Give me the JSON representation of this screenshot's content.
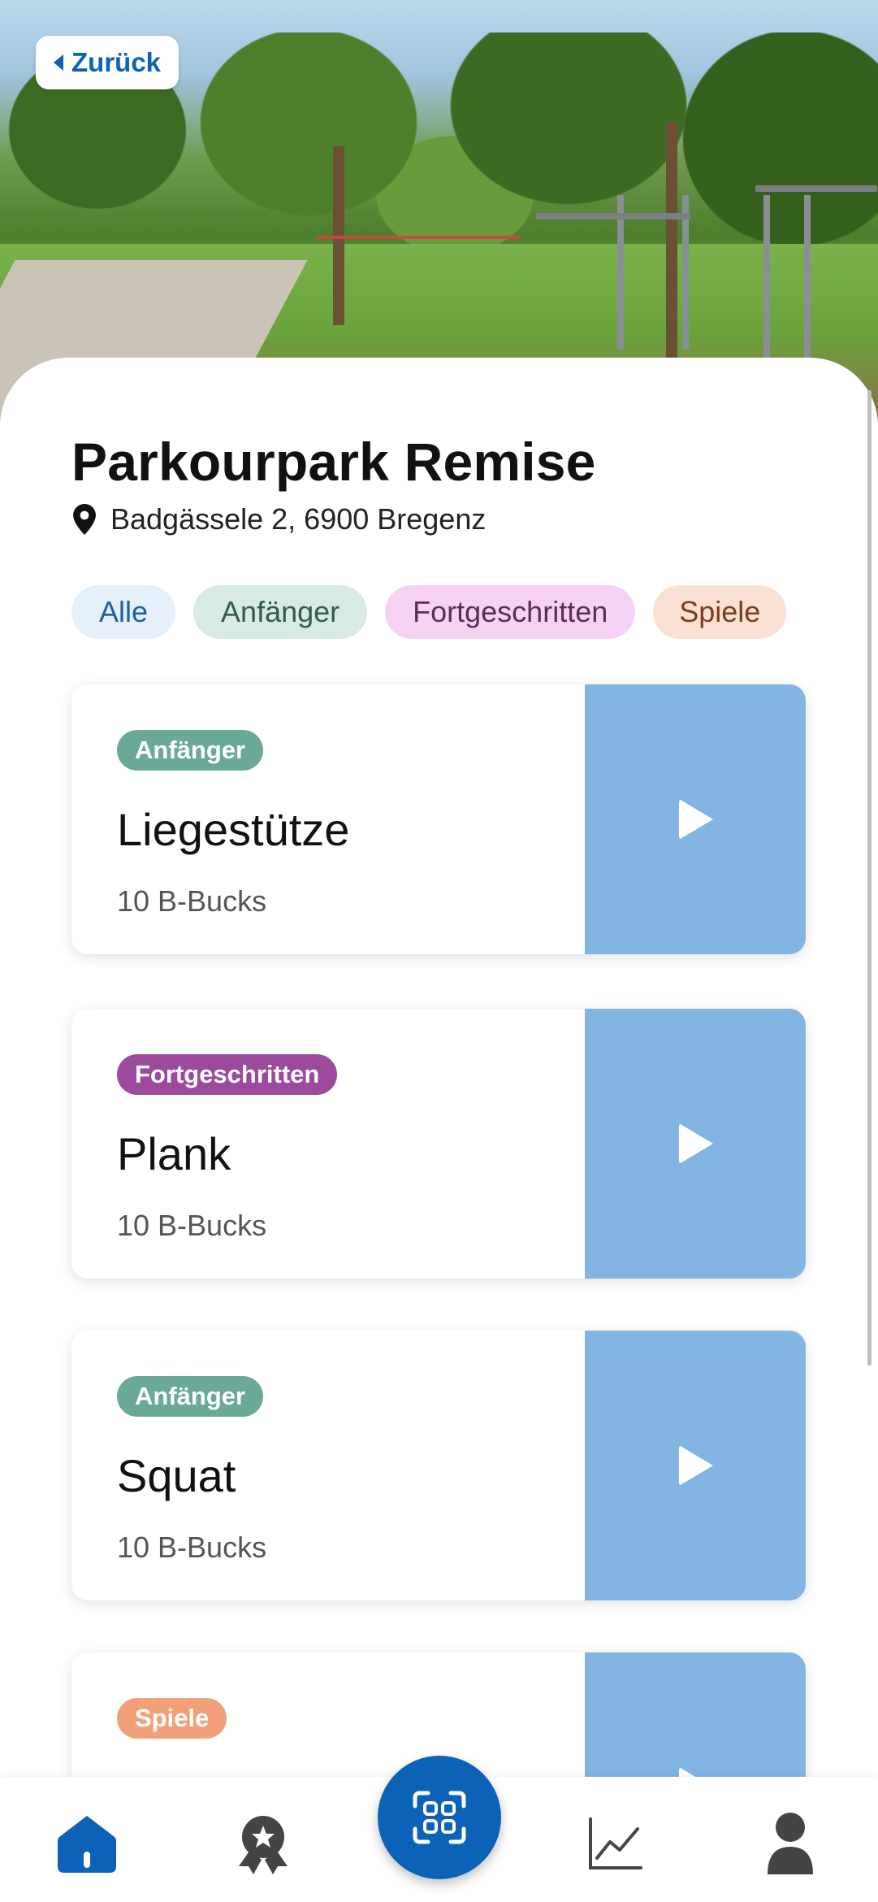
{
  "header": {
    "back_label": "Zurück"
  },
  "location": {
    "name": "Parkourpark Remise",
    "address": "Badgässele 2, 6900 Bregenz"
  },
  "filters": [
    {
      "label": "Alle",
      "selected": true
    },
    {
      "label": "Anfänger",
      "selected": false
    },
    {
      "label": "Fortgeschritten",
      "selected": false
    },
    {
      "label": "Spiele",
      "selected": false
    }
  ],
  "exercises": [
    {
      "level": "Anfänger",
      "name": "Liegestütze",
      "reward": "10 B-Bucks"
    },
    {
      "level": "Fortgeschritten",
      "name": "Plank",
      "reward": "10 B-Bucks"
    },
    {
      "level": "Anfänger",
      "name": "Squat",
      "reward": "10 B-Bucks"
    },
    {
      "level": "Spiele",
      "name": "",
      "reward": ""
    }
  ],
  "nav": {
    "items": [
      "home-icon",
      "badge-icon",
      "qr-scan-icon",
      "chart-icon",
      "profile-icon"
    ],
    "active": "home-icon"
  },
  "colors": {
    "accent": "#0b62b8",
    "media_placeholder": "#83b5e3",
    "badge_beginner": "#6aa898",
    "badge_advanced": "#9b4a9c",
    "badge_games": "#f2a07a"
  }
}
